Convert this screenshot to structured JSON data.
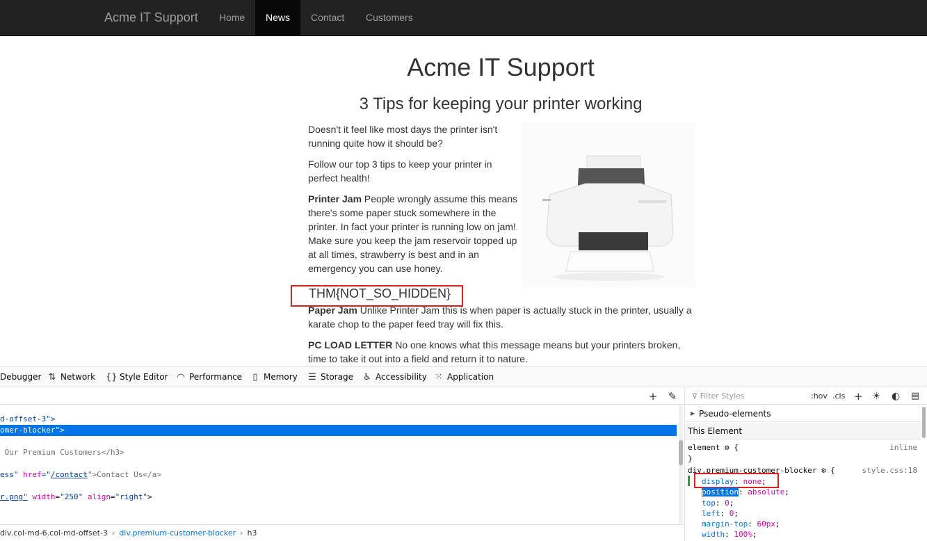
{
  "navbar": {
    "brand": "Acme IT Support",
    "items": [
      {
        "label": "Home"
      },
      {
        "label": "News"
      },
      {
        "label": "Contact"
      },
      {
        "label": "Customers"
      }
    ],
    "active": "News"
  },
  "page": {
    "title": "Acme IT Support",
    "article_title": "3 Tips for keeping your printer working",
    "paragraphs": [
      "Doesn't it feel like most days the printer isn't running quite how it should be?",
      "Follow our top 3 tips to keep your printer in perfect health!"
    ],
    "tip1_bold": "Printer Jam",
    "tip1_text": " People wrongly assume this means there's some paper stuck somewhere in the printer. In fact your printer is running low on jam! Make sure you keep the jam reservoir topped up at all times, strawberry is best and in an emergency you can use honey.",
    "flag": "THM{NOT_SO_HIDDEN}",
    "tip2_bold": "Paper Jam",
    "tip2_text": " Unlike Printer Jam this is when paper is actually stuck in the printer, usually a karate chop to the paper feed tray will fix this.",
    "tip3_bold": "PC LOAD LETTER",
    "tip3_text": " No one knows what this message means but your printers broken, time to take it out into a field and return it to nature."
  },
  "devtools": {
    "tabs": [
      {
        "label": "Debugger",
        "icon": "debugger-icon"
      },
      {
        "label": "Network",
        "icon": "network-icon"
      },
      {
        "label": "Style Editor",
        "icon": "braces-icon"
      },
      {
        "label": "Performance",
        "icon": "gauge-icon"
      },
      {
        "label": "Memory",
        "icon": "memory-icon"
      },
      {
        "label": "Storage",
        "icon": "storage-icon"
      },
      {
        "label": "Accessibility",
        "icon": "accessibility-icon"
      },
      {
        "label": "Application",
        "icon": "grid-icon"
      }
    ],
    "markup_lines": {
      "line1_pre": "d-offset-3\">",
      "line2_sel": "omer-blocker\">",
      "line3": " Our Premium Customers</h3>",
      "line4_a": "ess\" ",
      "line4_attr": "href",
      "line4_eq": "=\"",
      "line4_link": "/contact",
      "line4_rest": "\">Contact Us</a>",
      "line5_val": "r.png\"",
      "line5_attr1": "width",
      "line5_v1": "\"250\"",
      "line5_attr2": "align",
      "line5_v2": "\"right\"",
      "line5_end": ">"
    },
    "breadcrumb": {
      "item1": "div.col-md-6.col-md-offset-3",
      "item2": "div.premium-customer-blocker",
      "item3": "h3"
    },
    "rules": {
      "filter_placeholder": "Filter Styles",
      "hov": ":hov",
      "cls": ".cls",
      "pseudo_elements": "Pseudo-elements",
      "this_element": "This Element",
      "element_selector": "element",
      "element_source": "inline",
      "selector": "div.premium-customer-blocker",
      "source": "style.css:18",
      "decls": [
        {
          "prop": "display",
          "value": "none"
        },
        {
          "prop": "position",
          "value": "absolute"
        },
        {
          "prop": "top",
          "value": "0"
        },
        {
          "prop": "left",
          "value": "0"
        },
        {
          "prop": "margin-top",
          "value": "60px"
        },
        {
          "prop": "width",
          "value": "100%"
        }
      ]
    }
  }
}
